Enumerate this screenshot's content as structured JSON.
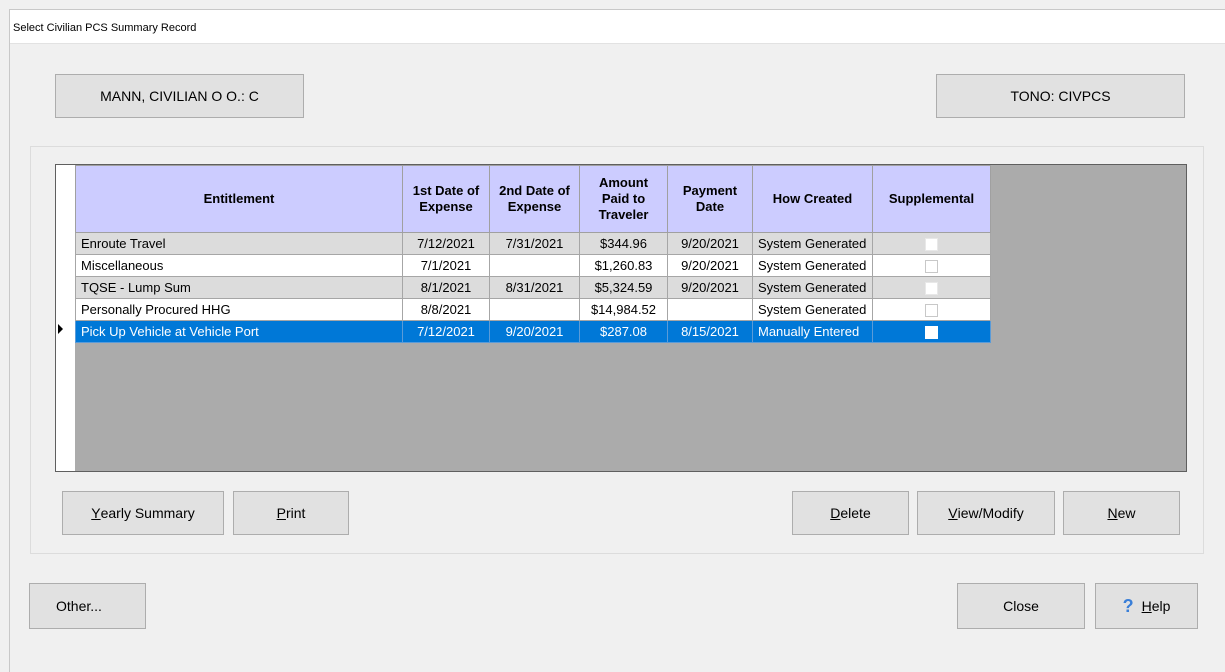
{
  "window": {
    "title": "Select Civilian PCS Summary Record"
  },
  "header": {
    "traveler_label": "MANN, CIVILIAN O O.: C",
    "tono_label": "TONO: CIVPCS"
  },
  "table": {
    "columns": [
      "Entitlement",
      "1st Date of Expense",
      "2nd Date of Expense",
      "Amount Paid to Traveler",
      "Payment Date",
      "How Created",
      "Supplemental"
    ],
    "rows": [
      {
        "entitlement": "Enroute Travel",
        "date1": "7/12/2021",
        "date2": "7/31/2021",
        "amount": "$344.96",
        "payment_date": "9/20/2021",
        "how_created": "System Generated",
        "supplemental": false
      },
      {
        "entitlement": "Miscellaneous",
        "date1": "7/1/2021",
        "date2": "",
        "amount": "$1,260.83",
        "payment_date": "9/20/2021",
        "how_created": "System Generated",
        "supplemental": false
      },
      {
        "entitlement": "TQSE - Lump Sum",
        "date1": "8/1/2021",
        "date2": "8/31/2021",
        "amount": "$5,324.59",
        "payment_date": "9/20/2021",
        "how_created": "System Generated",
        "supplemental": false
      },
      {
        "entitlement": "Personally Procured HHG",
        "date1": "8/8/2021",
        "date2": "",
        "amount": "$14,984.52",
        "payment_date": "",
        "how_created": "System Generated",
        "supplemental": false
      },
      {
        "entitlement": "Pick Up Vehicle at Vehicle Port",
        "date1": "7/12/2021",
        "date2": "9/20/2021",
        "amount": "$287.08",
        "payment_date": "8/15/2021",
        "how_created": "Manually Entered",
        "supplemental": false
      }
    ],
    "selected_row": 4
  },
  "buttons": {
    "yearly_summary": {
      "mnemonic": "Y",
      "rest": "early Summary"
    },
    "print": {
      "mnemonic": "P",
      "rest": "rint"
    },
    "delete": {
      "mnemonic": "D",
      "rest": "elete"
    },
    "view_modify": {
      "mnemonic": "V",
      "rest": "iew/Modify"
    },
    "new": {
      "mnemonic": "N",
      "rest": "ew"
    },
    "other": "Other...",
    "close": "Close",
    "help": {
      "mnemonic": "H",
      "rest": "elp",
      "icon": "question-mark-icon"
    }
  },
  "colors": {
    "header_bg": "#ccccff",
    "selection": "#0078d7",
    "alt_row": "#dcdcdc"
  }
}
